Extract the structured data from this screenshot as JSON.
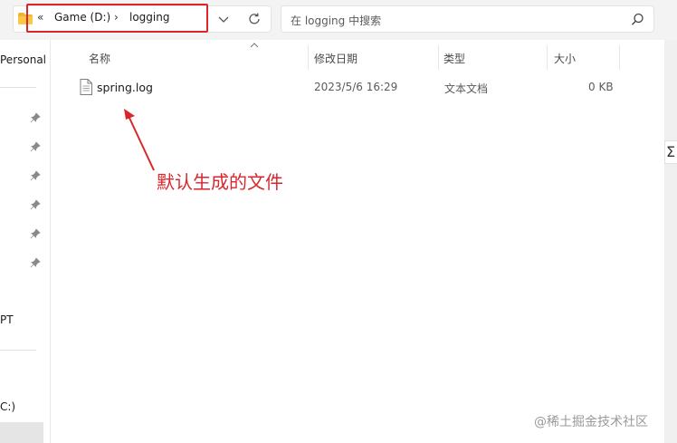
{
  "address_bar": {
    "overflow_label": "«",
    "crumbs": [
      "Game (D:)",
      "logging"
    ],
    "separator": "›"
  },
  "search": {
    "placeholder": "在 logging 中搜索"
  },
  "nav": {
    "items": [
      "Personal",
      "PT",
      "C:)"
    ]
  },
  "columns": {
    "name": "名称",
    "date_modified": "修改日期",
    "type": "类型",
    "size": "大小"
  },
  "files": [
    {
      "name": "spring.log",
      "date_modified": "2023/5/6 16:29",
      "type": "文本文档",
      "size": "0 KB",
      "icon": "text-file-icon"
    }
  ],
  "annotation": {
    "text": "默认生成的文件",
    "color": "#d9262c"
  },
  "watermark": "@稀土掘金技术社区",
  "colors": {
    "highlight": "#d9262c",
    "folder": "#f2b233"
  }
}
